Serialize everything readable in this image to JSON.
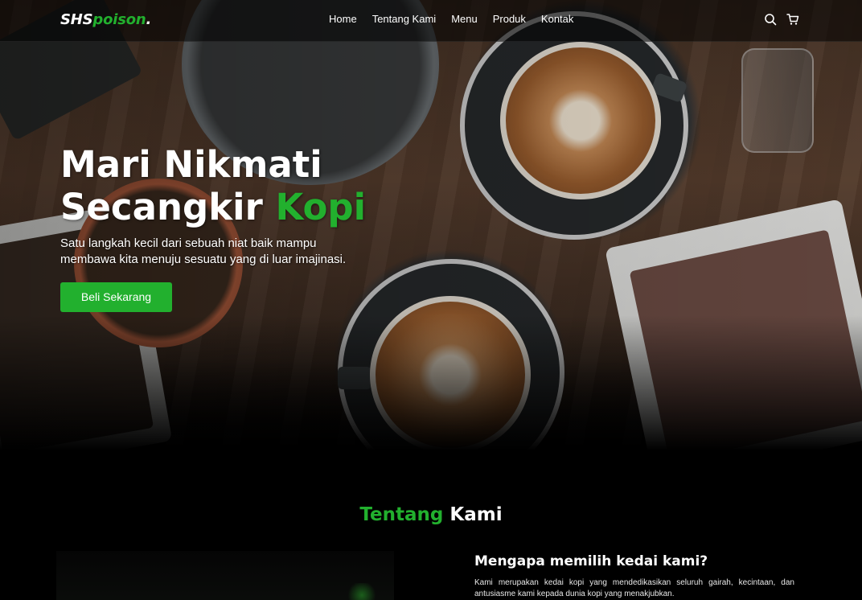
{
  "nav": {
    "logo_main": "SHS",
    "logo_accent": "poison",
    "logo_dot": ".",
    "links": [
      "Home",
      "Tentang Kami",
      "Menu",
      "Produk",
      "Kontak"
    ],
    "icons": [
      "search-icon",
      "shopping-cart-icon"
    ]
  },
  "hero": {
    "title_line1": "Mari Nikmati",
    "title_line2_plain": "Secangkir",
    "title_line2_accent": "Kopi",
    "text": "Satu langkah kecil dari sebuah niat baik mampu membawa kita menuju sesuatu yang di luar imajinasi.",
    "cta_label": "Beli Sekarang"
  },
  "about": {
    "title_accent": "Tentang",
    "title_plain": "Kami",
    "heading": "Mengapa memilih kedai kami?",
    "text": "Kami merupakan kedai kopi yang mendedikasikan seluruh gairah, kecintaan, dan antusiasme kami kepada dunia kopi yang menakjubkan."
  },
  "colors": {
    "accent": "#22b02e",
    "background": "#000000",
    "text": "#ffffff"
  }
}
